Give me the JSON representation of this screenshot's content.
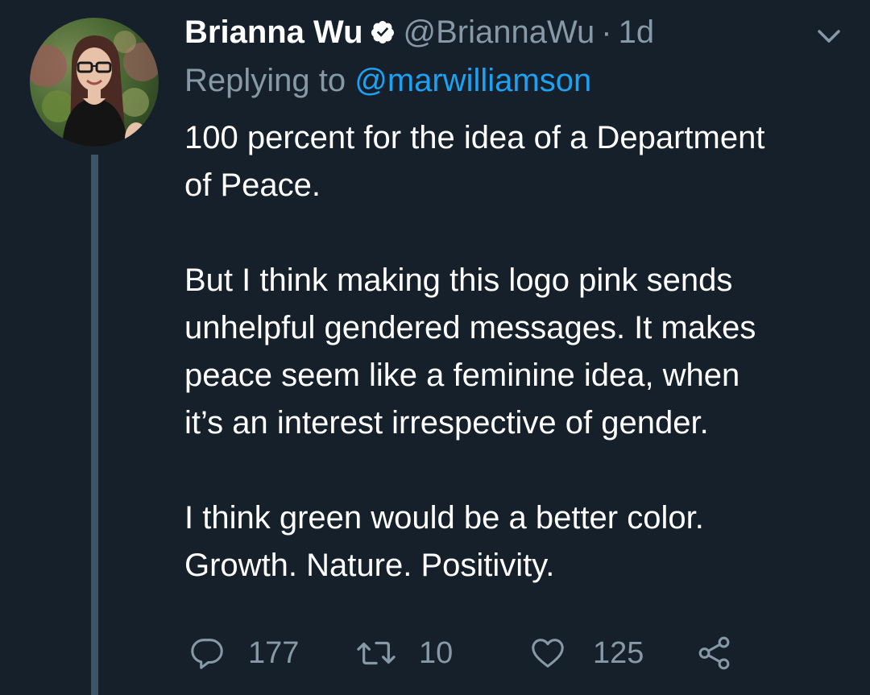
{
  "tweet": {
    "display_name": "Brianna Wu",
    "handle": "@BriannaWu",
    "separator": "·",
    "timestamp": "1d",
    "replying_prefix": "Replying to ",
    "replying_to": "@marwilliamson",
    "paragraphs": [
      [
        "100 percent for the idea of a Department",
        "of Peace."
      ],
      [
        "But I think making this logo pink sends",
        "unhelpful gendered messages. It makes",
        "peace seem like a feminine idea, when",
        "it’s an interest irrespective of gender."
      ],
      [
        "I think green would be a better color.",
        "Growth. Nature. Positivity."
      ]
    ],
    "actions": {
      "replies": "177",
      "retweets": "10",
      "likes": "125"
    }
  },
  "icons": {
    "verified": "verified-badge-icon",
    "caret": "chevron-down-icon",
    "reply": "reply-bubble-icon",
    "retweet": "retweet-arrows-icon",
    "like": "heart-icon",
    "share": "share-icon"
  },
  "colors": {
    "background": "#15202b",
    "text": "#ffffff",
    "secondary": "#8899a6",
    "link": "#1da1f2",
    "thread_line": "#3d5466"
  }
}
